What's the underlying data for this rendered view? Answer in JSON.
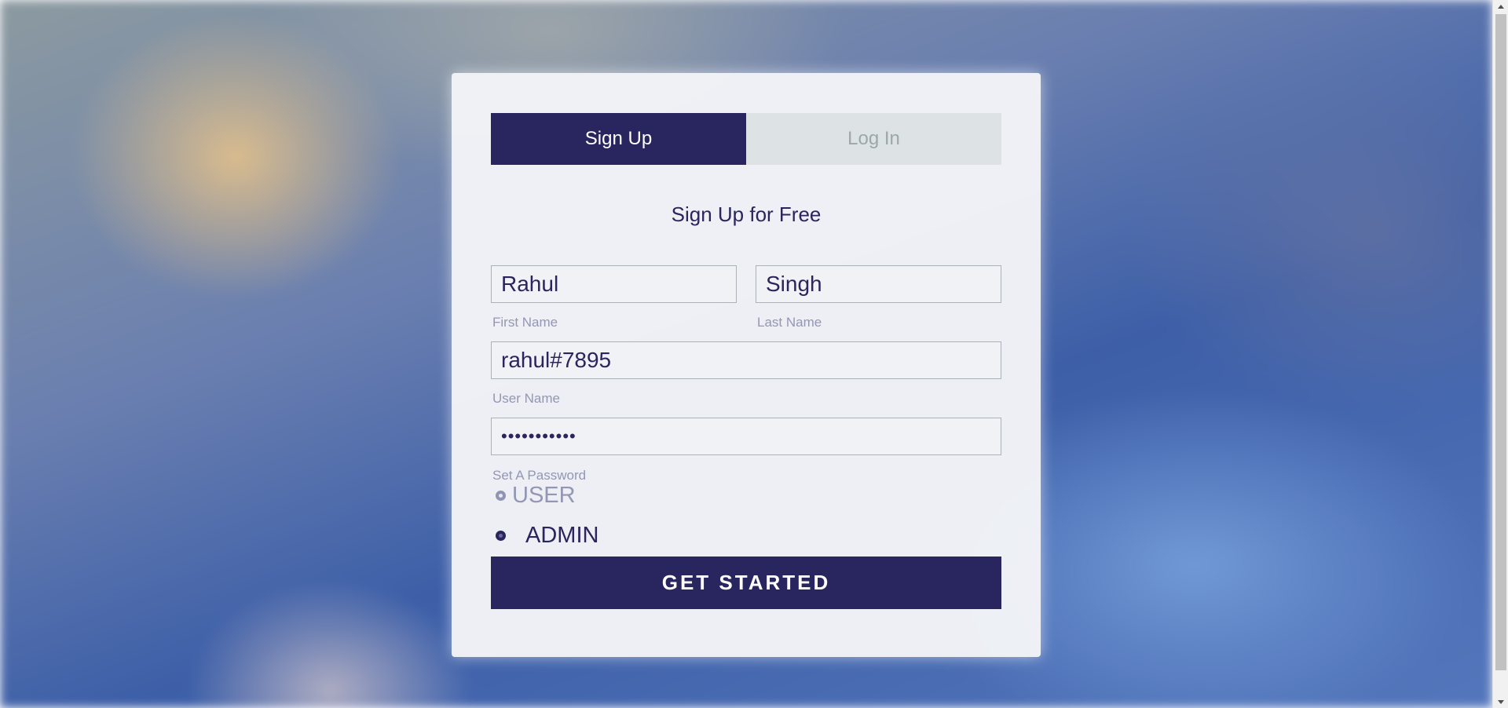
{
  "tabs": {
    "signup_label": "Sign Up",
    "login_label": "Log In"
  },
  "heading": "Sign Up for Free",
  "form": {
    "first_name": {
      "value": "Rahul",
      "label": "First Name"
    },
    "last_name": {
      "value": "Singh",
      "label": "Last Name"
    },
    "user_name": {
      "value": "rahul#7895",
      "label": "User Name"
    },
    "password": {
      "value": "•••••••••••",
      "label": "Set A Password"
    },
    "roles": [
      {
        "label": "USER"
      },
      {
        "label": "ADMIN"
      }
    ]
  },
  "cta_label": "GET STARTED",
  "colors": {
    "primary": "#29255e",
    "inactive_tab_bg": "#dde3e4",
    "inactive_tab_text": "#9aa7ab",
    "label_text": "#9397b3"
  }
}
